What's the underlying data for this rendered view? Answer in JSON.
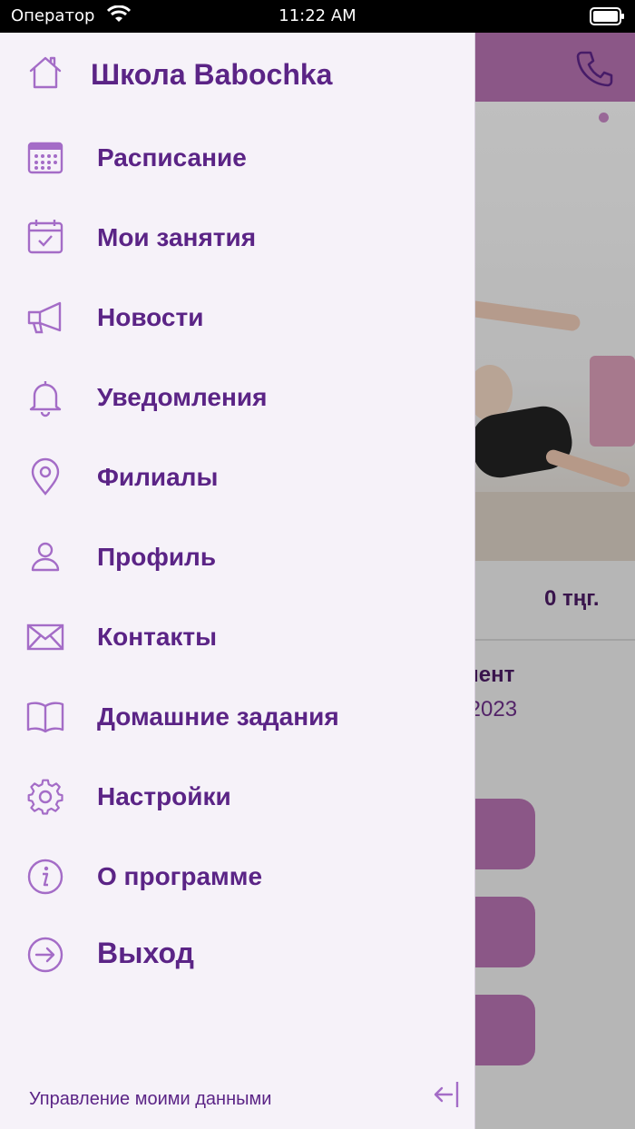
{
  "status_bar": {
    "carrier": "Оператор",
    "time": "11:22 AM"
  },
  "drawer": {
    "title": "Школа Babochka",
    "items": [
      {
        "label": "Расписание",
        "icon": "calendar-grid-icon"
      },
      {
        "label": "Мои занятия",
        "icon": "calendar-check-icon"
      },
      {
        "label": "Новости",
        "icon": "megaphone-icon"
      },
      {
        "label": "Уведомления",
        "icon": "bell-icon"
      },
      {
        "label": "Филиалы",
        "icon": "location-pin-icon"
      },
      {
        "label": "Профиль",
        "icon": "person-icon"
      },
      {
        "label": "Контакты",
        "icon": "envelope-icon"
      },
      {
        "label": "Домашние задания",
        "icon": "book-icon"
      },
      {
        "label": "Настройки",
        "icon": "gear-icon"
      },
      {
        "label": "О программе",
        "icon": "info-icon"
      },
      {
        "label": "Выход",
        "icon": "exit-arrow-icon"
      }
    ],
    "footer": "Управление моими данными"
  },
  "background": {
    "price": "0 тңг.",
    "text_1": "мент",
    "text_2": ".2023"
  },
  "colors": {
    "accent": "#5b2486",
    "icon": "#a46cc7",
    "header": "#b270ad",
    "drawer_bg": "#f6f2f9"
  }
}
